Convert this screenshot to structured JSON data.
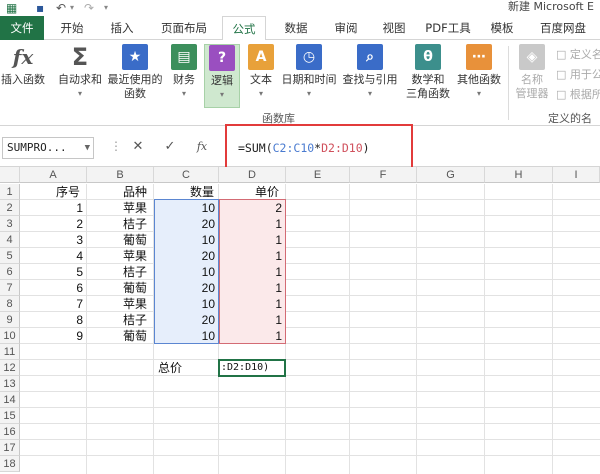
{
  "window": {
    "title": "新建 Microsoft E"
  },
  "quick_access": {
    "save_icon": "save-icon",
    "undo_icon": "undo-icon",
    "redo_icon": "redo-icon"
  },
  "tabs": [
    {
      "label": "文件"
    },
    {
      "label": "开始"
    },
    {
      "label": "插入"
    },
    {
      "label": "页面布局"
    },
    {
      "label": "公式"
    },
    {
      "label": "数据"
    },
    {
      "label": "审阅"
    },
    {
      "label": "视图"
    },
    {
      "label": "PDF工具"
    },
    {
      "label": "模板"
    },
    {
      "label": "百度网盘"
    }
  ],
  "ribbon": {
    "insert_function": "插入函数",
    "autosum": "自动求和",
    "recent": "最近使用的",
    "recent2": "函数",
    "financial": "财务",
    "logical": "逻辑",
    "text": "文本",
    "datetime": "日期和时间",
    "lookup": "查找与引用",
    "math": "数学和",
    "math2": "三角函数",
    "more": "其他函数",
    "name_manager": "名称",
    "name_manager2": "管理器",
    "define_name": "定义名",
    "use_in_formula": "用于公",
    "create_from_sel": "根据所",
    "group_library": "函数库",
    "group_defined": "定义的名"
  },
  "formula_bar": {
    "name_box": "SUMPRO...",
    "cancel": "✕",
    "enter": "✓",
    "fx": "fx",
    "formula_prefix": "=SUM(",
    "formula_ref1": "C2:C10",
    "formula_op": "*",
    "formula_ref2": "D2:D10",
    "formula_suffix": ")"
  },
  "columns": [
    "A",
    "B",
    "C",
    "D",
    "E",
    "F",
    "G",
    "H",
    "I"
  ],
  "rows": [
    "1",
    "2",
    "3",
    "4",
    "5",
    "6",
    "7",
    "8",
    "9",
    "10",
    "11",
    "12",
    "13",
    "14",
    "15",
    "16",
    "17",
    "18"
  ],
  "table": {
    "header": {
      "a": "序号",
      "b": "品种",
      "c": "数量",
      "d": "单价"
    },
    "data": [
      {
        "a": "1",
        "b": "苹果",
        "c": "10",
        "d": "2"
      },
      {
        "a": "2",
        "b": "桔子",
        "c": "20",
        "d": "1"
      },
      {
        "a": "3",
        "b": "葡萄",
        "c": "10",
        "d": "1"
      },
      {
        "a": "4",
        "b": "苹果",
        "c": "20",
        "d": "1"
      },
      {
        "a": "5",
        "b": "桔子",
        "c": "10",
        "d": "1"
      },
      {
        "a": "6",
        "b": "葡萄",
        "c": "20",
        "d": "1"
      },
      {
        "a": "7",
        "b": "苹果",
        "c": "10",
        "d": "1"
      },
      {
        "a": "8",
        "b": "桔子",
        "c": "20",
        "d": "1"
      },
      {
        "a": "9",
        "b": "葡萄",
        "c": "10",
        "d": "1"
      }
    ],
    "total_label": "总价",
    "editing_cell": ":D2:D10)"
  },
  "colors": {
    "excel_green": "#217346",
    "ref_blue": "#4a7bd0",
    "ref_red": "#d0505c",
    "callout_red": "#e23b3b"
  }
}
